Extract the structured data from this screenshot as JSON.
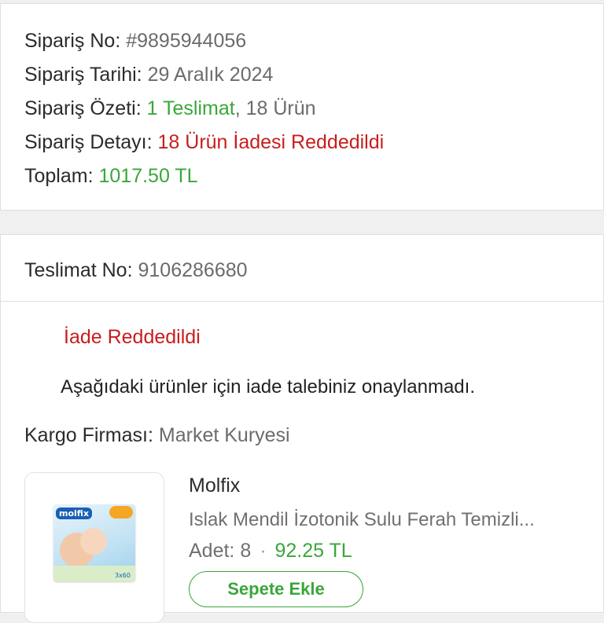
{
  "order": {
    "no_label": "Sipariş No:",
    "no_value": "#9895944056",
    "date_label": "Sipariş Tarihi:",
    "date_value": "29 Aralık 2024",
    "summary_label": "Sipariş Özeti:",
    "summary_delivery": "1 Teslimat",
    "summary_sep": ",",
    "summary_items": "18 Ürün",
    "detail_label": "Sipariş Detayı:",
    "detail_value": "18 Ürün İadesi Reddedildi",
    "total_label": "Toplam:",
    "total_value": "1017.50 TL"
  },
  "delivery": {
    "no_label": "Teslimat No:",
    "no_value": "9106286680",
    "return_status": "İade Reddedildi",
    "return_message": "Aşağıdaki ürünler için iade talebiniz onaylanmadı.",
    "cargo_label": "Kargo Firması:",
    "cargo_value": "Market Kuryesi"
  },
  "product": {
    "brand": "Molfix",
    "name": "Islak Mendil İzotonik Sulu Ferah Temizli...",
    "qty_label": "Adet:",
    "qty_value": "8",
    "separator": "·",
    "price": "92.25 TL",
    "add_to_cart_label": "Sepete Ekle",
    "image_logo_text": "molfix",
    "image_count_text": "3x60"
  },
  "colors": {
    "accent_green": "#3aa63a",
    "status_red": "#c81e1e"
  }
}
